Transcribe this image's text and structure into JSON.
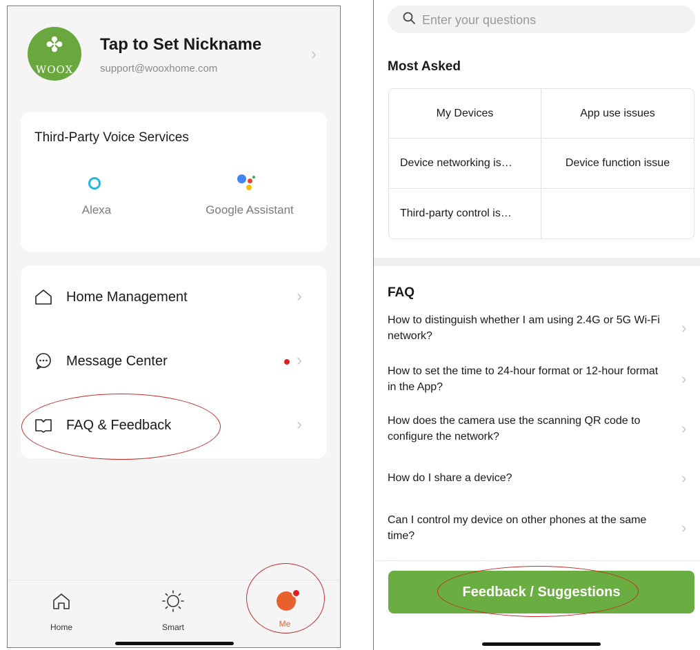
{
  "left": {
    "profile": {
      "avatar_text": "WOOX",
      "nickname": "Tap to Set Nickname",
      "email": "support@wooxhome.com"
    },
    "voice": {
      "title": "Third-Party Voice Services",
      "items": [
        {
          "label": "Alexa",
          "icon": "alexa-icon"
        },
        {
          "label": "Google Assistant",
          "icon": "google-assistant-icon"
        }
      ]
    },
    "menu": [
      {
        "label": "Home Management",
        "icon": "home-icon"
      },
      {
        "label": "Message Center",
        "icon": "message-icon",
        "badge": true
      },
      {
        "label": "FAQ & Feedback",
        "icon": "book-icon"
      }
    ],
    "tabs": [
      {
        "label": "Home",
        "icon": "home-icon"
      },
      {
        "label": "Smart",
        "icon": "sun-icon"
      },
      {
        "label": "Me",
        "icon": "person-icon",
        "active": true
      }
    ]
  },
  "right": {
    "search": {
      "placeholder": "Enter your questions",
      "value": ""
    },
    "most_asked": {
      "title": "Most Asked",
      "cells": [
        "My Devices",
        "App use issues",
        "Device networking is…",
        "Device function issue",
        "Third-party control is…",
        ""
      ]
    },
    "faq": {
      "title": "FAQ",
      "items": [
        "How to distinguish whether I am using 2.4G or 5G Wi-Fi network?",
        "How to set the time to 24-hour format or 12-hour format in the App?",
        "How does the camera use the scanning QR code to configure the network?",
        "How do I share a device?",
        "Can I control my device on other phones at the same time?"
      ]
    },
    "feedback_button": "Feedback / Suggestions"
  },
  "colors": {
    "brand_green": "#6aad40",
    "accent_orange": "#e8612c",
    "annotation_red": "#c62b2b",
    "badge_red": "#e02020"
  }
}
